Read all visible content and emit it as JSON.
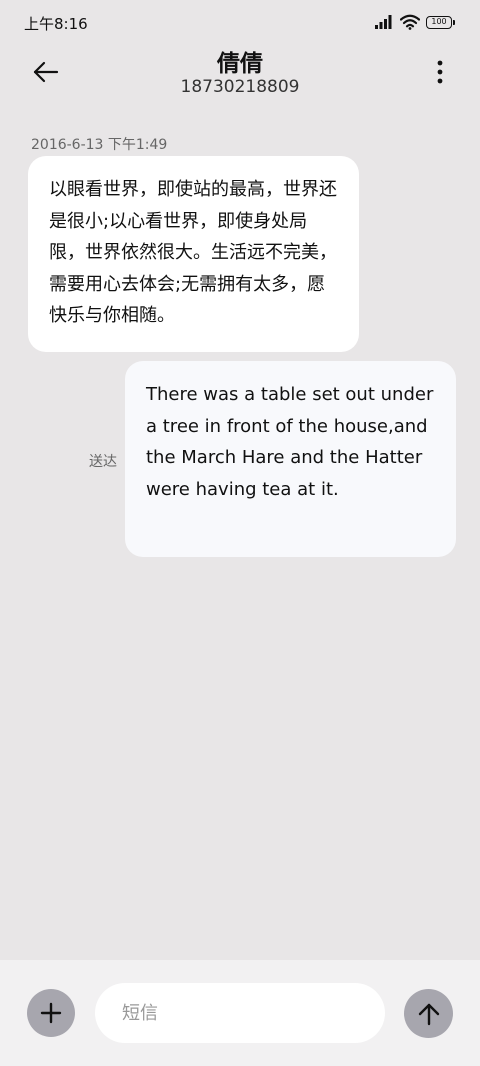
{
  "status_bar": {
    "time": "上午8:16",
    "battery_level": "100",
    "icons": [
      "signal-icon",
      "wifi-icon",
      "battery-icon"
    ]
  },
  "header": {
    "contact_name": "倩倩",
    "contact_number": "18730218809",
    "back_icon": "arrow-left-icon",
    "more_icon": "more-vertical-icon"
  },
  "conversation": {
    "timestamp": "2016-6-13 下午1:49",
    "messages": [
      {
        "direction": "received",
        "text": "以眼看世界，即使站的最高，世界还是很小;以心看世界，即使身处局限，世界依然很大。生活远不完美，需要用心去体会;无需拥有太多，愿快乐与你相随。"
      },
      {
        "direction": "sent",
        "text": "There was a table set out under a tree in front of the house,and the March Hare and the Hatter were having tea at it.",
        "status": "送达"
      }
    ]
  },
  "composer": {
    "placeholder": "短信",
    "value": "",
    "add_icon": "plus-icon",
    "send_icon": "arrow-up-icon"
  },
  "colors": {
    "background": "#e8e6e7",
    "bubble_received": "#ffffff",
    "bubble_sent": "#f8f9fc",
    "action_button": "#a7a6ae",
    "input_bar": "#f2f1f2"
  }
}
